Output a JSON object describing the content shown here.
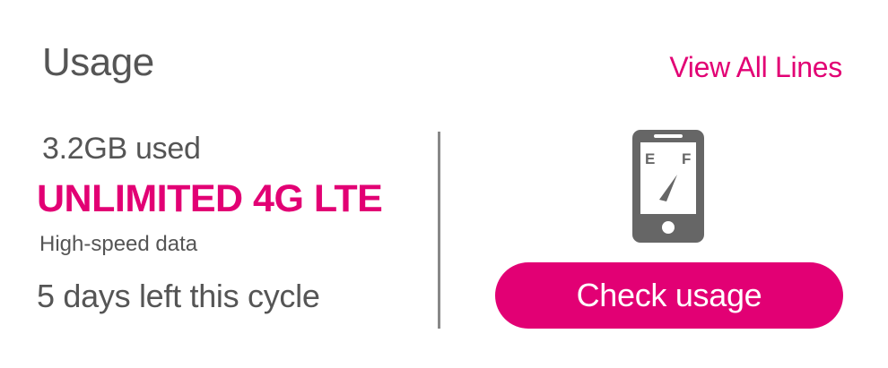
{
  "header": {
    "title": "Usage",
    "view_all_label": "View All Lines"
  },
  "usage": {
    "used_text": "3.2GB used",
    "plan_name": "UNLIMITED 4G LTE",
    "plan_detail": "High-speed data",
    "days_left_text": "5 days left this cycle"
  },
  "gauge": {
    "empty_label": "E",
    "full_label": "F",
    "icon": "phone-fuel-gauge-icon"
  },
  "actions": {
    "check_usage_label": "Check usage"
  },
  "colors": {
    "accent": "#e20074",
    "text": "#555555",
    "icon": "#666666",
    "divider": "#888888"
  }
}
